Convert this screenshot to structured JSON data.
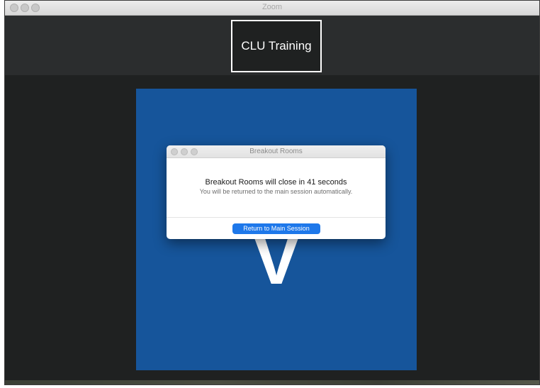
{
  "window": {
    "title": "Zoom",
    "controls": [
      "close-icon",
      "minimize-icon",
      "zoom-icon"
    ]
  },
  "meeting": {
    "name_tag": "CLU Training",
    "participant_initial": "V"
  },
  "dialog": {
    "title": "Breakout Rooms",
    "heading": "Breakout Rooms will close in 41 seconds",
    "message": "You will be returned to the main session automatically.",
    "button_label": "Return to Main Session"
  },
  "colors": {
    "tile_background": "#16559b",
    "button_accent": "#1e78ea",
    "window_background": "#1f2121"
  }
}
